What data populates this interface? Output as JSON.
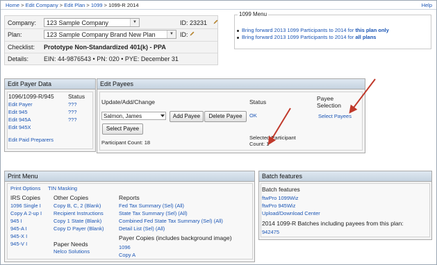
{
  "breadcrumb": {
    "items": [
      "Home",
      "Edit Company",
      "Edit Plan",
      "1099"
    ],
    "current": "1099-R 2014",
    "separator": ">"
  },
  "help_label": "Help",
  "info": {
    "company_label": "Company:",
    "company_value": "123 Sample Company",
    "company_id_label": "ID: 23231",
    "plan_label": "Plan:",
    "plan_value": "123 Sample Company Brand New Plan",
    "plan_id_label": "ID:",
    "checklist_label": "Checklist:",
    "checklist_value": "Prototype Non-Standardized 401(k) - PPA",
    "details_label": "Details:",
    "details_value": "EIN: 44-9876543 • PN: 020 • PYE: December 31"
  },
  "menu_1099": {
    "legend": "1099 Menu",
    "items": [
      {
        "text": "Bring forward 2013 1099 Participants to 2014 for ",
        "emph": "this plan only"
      },
      {
        "text": "Bring forward 2013 1099 Participants to 2014 for ",
        "emph": "all plans"
      }
    ]
  },
  "payer_panel": {
    "title": "Edit Payer Data",
    "col1_header": "1096/1099-R/945",
    "col2_header": "Status",
    "rows": [
      {
        "link": "Edit Payer",
        "status": "???"
      },
      {
        "link": "Edit 945",
        "status": "???"
      },
      {
        "link": "Edit 945A",
        "status": "???"
      },
      {
        "link": "Edit 945X",
        "status": ""
      }
    ],
    "paid_preparers": "Edit Paid Preparers"
  },
  "payees_panel": {
    "title": "Edit Payees",
    "col1_header": "Update/Add/Change",
    "col2_header": "Status",
    "col3_header": "Payee Selection",
    "payee_selected": "Salmon, James",
    "add_button": "Add Payee",
    "delete_button": "Delete Payee",
    "select_button": "Select Payee",
    "status_value": "OK",
    "select_payees_link": "Select Payees",
    "participant_count": "Participant Count: 18",
    "selected_count_line1": "Selected Participant",
    "selected_count_line2": "Count: 1"
  },
  "print_panel": {
    "title": "Print Menu",
    "top_links": [
      "Print Options",
      "TIN Masking"
    ],
    "irs_header": "IRS Copies",
    "irs_links": [
      "1096 Single I",
      "Copy A 2-up I",
      "945 I",
      "945-A I",
      "945-X I",
      "945-V I"
    ],
    "other_header": "Other Copies",
    "other_links": [
      "Copy B, C, 2 (Blank)",
      "Recipient Instructions",
      "Copy 1 State (Blank)",
      "Copy D Payer (Blank)"
    ],
    "paper_header": "Paper Needs",
    "paper_links": [
      "Nelco Solutions"
    ],
    "reports_header": "Reports",
    "reports_links": [
      "Fed Tax Summary (Sel) (All)",
      "State Tax Summary (Sel) (All)",
      "Combined Fed State Tax Summary (Sel) (All)",
      "Detail List (Sel) (All)"
    ],
    "payer_copies_header": "Payer Copies (includes background image)",
    "payer_copies_links": [
      "1096",
      "Copy A"
    ]
  },
  "batch_panel": {
    "title": "Batch features",
    "subheader": "Batch features",
    "links": [
      "ftwPro 1099Wiz",
      "ftwPro 945Wiz",
      "Upload/Download Center"
    ],
    "batches_header": "2014 1099-R Batches including payees from this plan:",
    "batch_ids": [
      "942475"
    ]
  },
  "colors": {
    "link": "#1a55b5",
    "panel_header": "#c5d3e0",
    "annotation_arrow": "#c0392b"
  }
}
